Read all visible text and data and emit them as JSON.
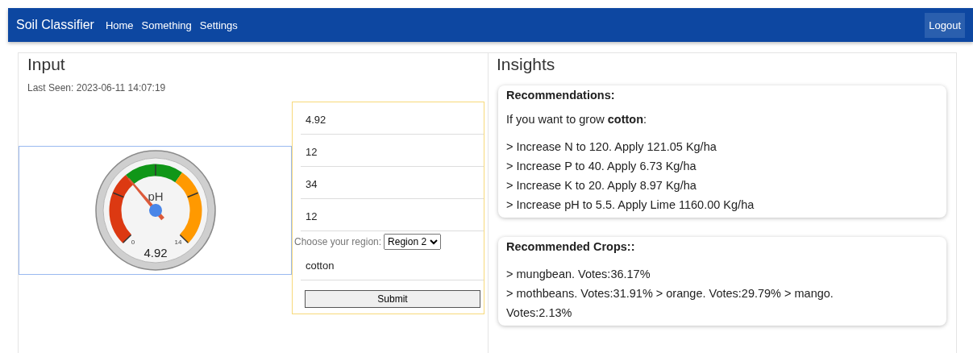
{
  "navbar": {
    "brand": "Soil Classifier",
    "links": [
      "Home",
      "Something",
      "Settings"
    ],
    "logout": "Logout"
  },
  "input": {
    "title": "Input",
    "last_seen": "Last Seen: 2023-06-11 14:07:19",
    "gauge": {
      "label": "pH",
      "value": "4.92",
      "min": "0",
      "max": "14",
      "level": 0.351
    },
    "fields": [
      {
        "value": "4.92"
      },
      {
        "value": "12"
      },
      {
        "value": "34"
      },
      {
        "value": "12"
      }
    ],
    "region": {
      "label": "Choose your region:",
      "value": "Region 2"
    },
    "crop_field": {
      "value": "cotton"
    },
    "submit": "Submit"
  },
  "insights": {
    "title": "Insights",
    "cards": [
      {
        "title": "Recommendations:",
        "intro": "If you want to grow **cotton**:",
        "lines": [
          "> Increase N to 120. Apply 121.05 Kg/ha",
          "> Increase P to 40. Apply 6.73 Kg/ha",
          "> Increase K to 20. Apply 8.97 Kg/ha",
          "> Increase pH to 5.5. Apply Lime 1160.00 Kg/ha"
        ]
      },
      {
        "title": "Recommended Crops::",
        "lines": [
          "> mungbean. Votes:36.17%",
          "> mothbeans. Votes:31.91% > orange. Votes:29.79% > mango. Votes:2.13%"
        ]
      }
    ]
  }
}
